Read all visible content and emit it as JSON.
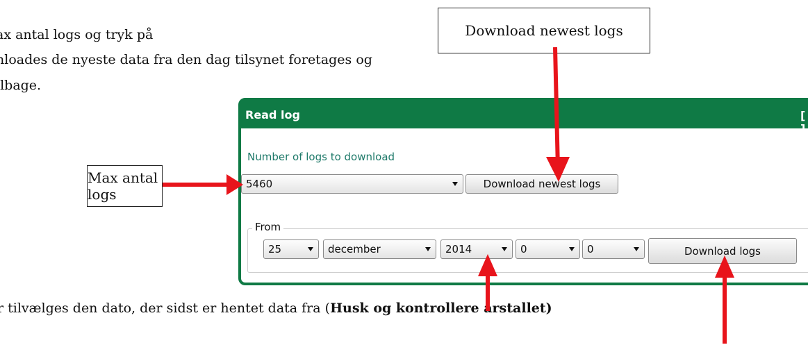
{
  "doc": {
    "line1": "ax antal logs og tryk på",
    "line2": "nloades de nyeste data fra den dag tilsynet foretages og",
    "line3": "ilbage.",
    "bottom_prefix": "r tilvælges den dato, der sidst er hentet data fra (",
    "bottom_bold": "Husk og kontrollere årstallet)"
  },
  "callouts": {
    "download_newest": "Download newest logs",
    "max_antal": "Max antal logs"
  },
  "panel": {
    "title": "Read log",
    "help": "[ ? ]",
    "number_label": "Number of logs to download",
    "number_value": "5460",
    "download_newest_label": "Download newest logs",
    "from_label": "From",
    "day": "25",
    "month": "december",
    "year": "2014",
    "hour": "0",
    "minute": "0",
    "download_logs_label": "Download logs"
  },
  "colors": {
    "panel_green": "#0f7a45",
    "arrow_red": "#e8141b"
  }
}
